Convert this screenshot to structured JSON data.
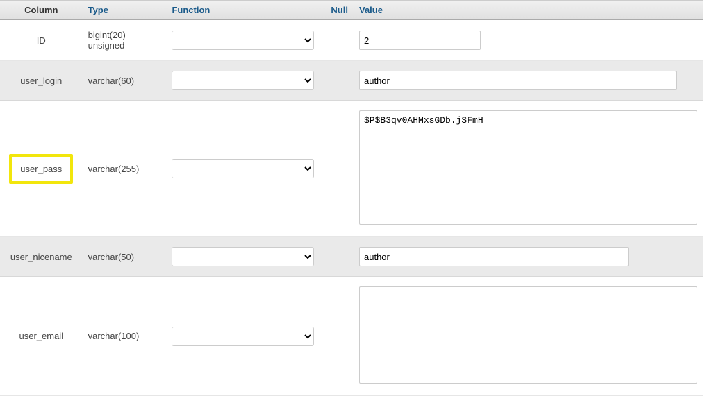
{
  "headers": {
    "column": "Column",
    "type": "Type",
    "function": "Function",
    "null": "Null",
    "value": "Value"
  },
  "rows": [
    {
      "column": "ID",
      "type": "bigint(20) unsigned",
      "value": "2",
      "highlighted": false,
      "value_kind": "input",
      "input_class": "input-id"
    },
    {
      "column": "user_login",
      "type": "varchar(60)",
      "value": "author",
      "highlighted": false,
      "value_kind": "input",
      "input_class": "input-login"
    },
    {
      "column": "user_pass",
      "type": "varchar(255)",
      "value": "$P$B3qv0AHMxsGDb.jSFmH",
      "highlighted": true,
      "value_kind": "textarea",
      "input_class": "textarea-pass"
    },
    {
      "column": "user_nicename",
      "type": "varchar(50)",
      "value": "author",
      "highlighted": false,
      "value_kind": "input",
      "input_class": "input-nicename"
    },
    {
      "column": "user_email",
      "type": "varchar(100)",
      "value": "",
      "highlighted": false,
      "value_kind": "textarea",
      "input_class": "textarea-email"
    }
  ]
}
